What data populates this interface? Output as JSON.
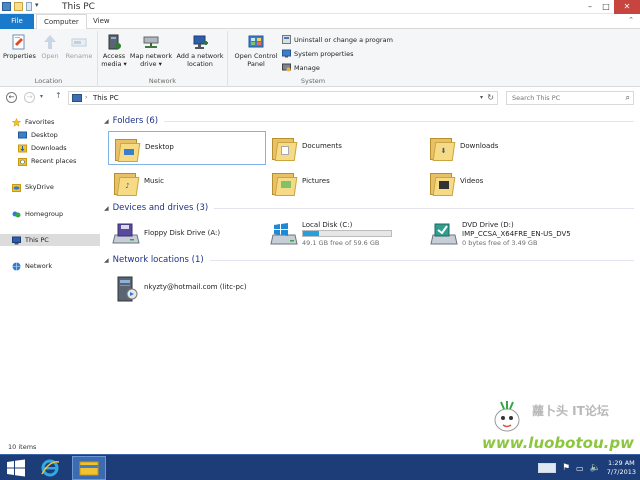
{
  "window": {
    "title": "This PC",
    "minimize": "–",
    "maximize": "□",
    "close": "✕"
  },
  "ribbon_tabs": [
    "File",
    "Computer",
    "View"
  ],
  "ribbon": {
    "location": {
      "label": "Location",
      "buttons": [
        "Properties",
        "Open",
        "Rename"
      ]
    },
    "network": {
      "label": "Network",
      "access_media": [
        "Access",
        "media ▾"
      ],
      "map_drive": [
        "Map network",
        "drive ▾"
      ],
      "add_location": [
        "Add a network",
        "location"
      ]
    },
    "system": {
      "label": "System",
      "control_panel": [
        "Open Control",
        "Panel"
      ],
      "uninstall": "Uninstall or change a program",
      "sys_props": "System properties",
      "manage": "Manage"
    }
  },
  "address": {
    "back": "←",
    "forward": "→",
    "up": "↑",
    "breadcrumb": "This PC",
    "search_placeholder": "Search This PC",
    "refresh": "↻",
    "dropdown": "▾",
    "sep": "›",
    "search_icon": "⌕"
  },
  "nav": {
    "favorites": "Favorites",
    "desktop": "Desktop",
    "downloads": "Downloads",
    "recent_places": "Recent places",
    "skydrive": "SkyDrive",
    "homegroup": "Homegroup",
    "this_pc": "This PC",
    "network": "Network"
  },
  "sections": {
    "folders": "Folders (6)",
    "devices": "Devices and drives (3)",
    "network": "Network locations (1)"
  },
  "folders": [
    "Desktop",
    "Documents",
    "Downloads",
    "Music",
    "Pictures",
    "Videos"
  ],
  "drives": {
    "floppy": {
      "name": "Floppy Disk Drive (A:)"
    },
    "local": {
      "name": "Local Disk (C:)",
      "free": "49.1 GB free of 59.6 GB",
      "used_fraction": 0.18
    },
    "dvd": {
      "name": "DVD Drive (D:)",
      "label": "IMP_CCSA_X64FRE_EN-US_DV5",
      "free": "0 bytes free of 3.49 GB"
    }
  },
  "network_location": "nkyzty@hotmail.com (litc-pc)",
  "status": {
    "item_count": "10 items"
  },
  "watermark": {
    "brand": "蘿卜头 IT论坛",
    "url": "www.luobotou.pw"
  },
  "taskbar": {
    "time": "1:29 AM",
    "date": "7/7/2013"
  },
  "colors": {
    "accent": "#1979ca",
    "section_title": "#1e3287",
    "taskbar": "#1c3d78",
    "progress": "#26a0da"
  }
}
